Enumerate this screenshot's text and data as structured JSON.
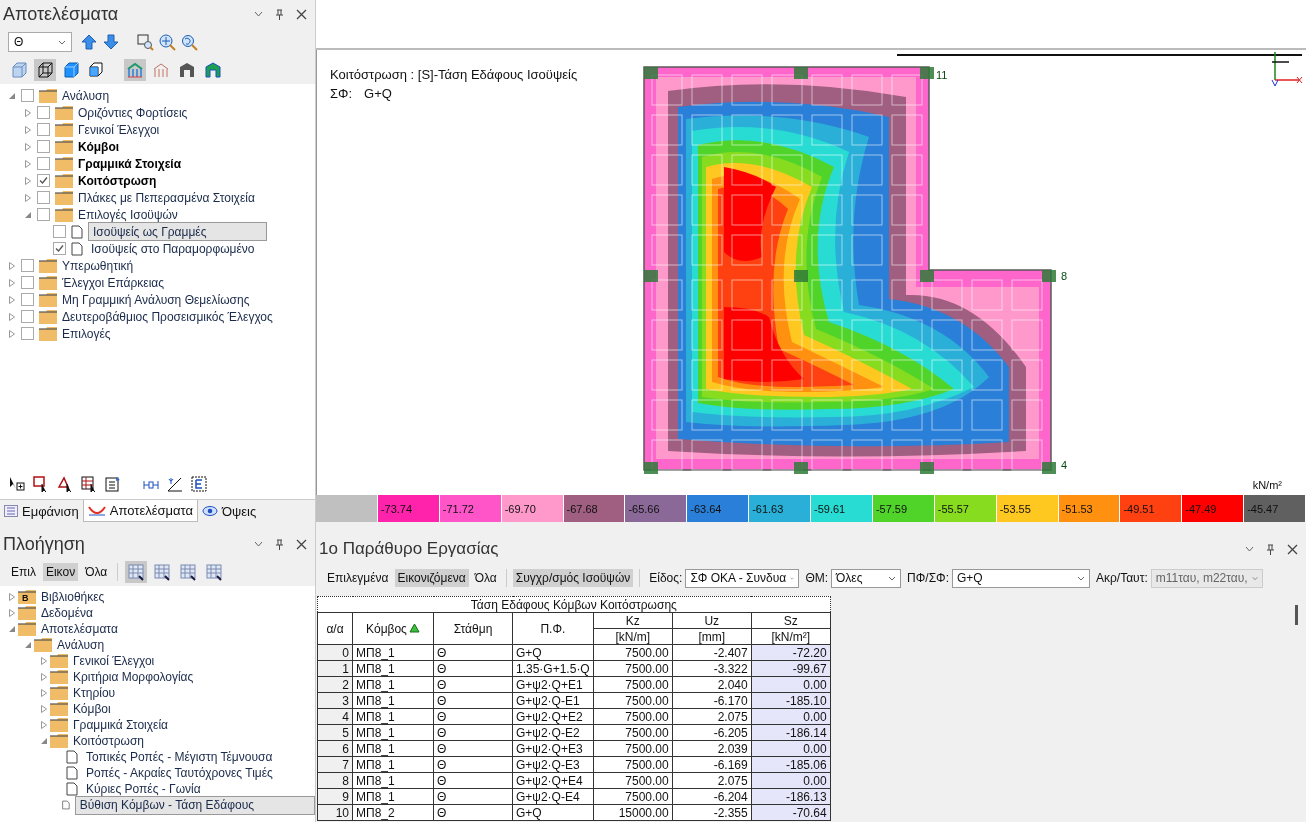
{
  "results_panel": {
    "title": "Αποτελέσματα",
    "level_select": {
      "value": "Θ"
    },
    "view_tools": [
      {
        "selected": false
      },
      {
        "selected": true
      },
      {
        "selected": false
      },
      {
        "selected": false
      },
      {
        "selected": true
      },
      {
        "selected": false
      },
      {
        "selected": false
      },
      {
        "selected": false
      }
    ],
    "tree": [
      {
        "label": "Ανάλυση",
        "kind": "folder",
        "checked": false,
        "expanded": true,
        "bold": false,
        "selected": false,
        "children": [
          {
            "label": "Οριζόντιες Φορτίσεις",
            "kind": "folder",
            "checked": false,
            "expanded": false,
            "bold": false,
            "selected": false
          },
          {
            "label": "Γενικοί Έλεγχοι",
            "kind": "folder",
            "checked": false,
            "expanded": false,
            "bold": false,
            "selected": false
          },
          {
            "label": "Κόμβοι",
            "kind": "folder",
            "checked": false,
            "expanded": false,
            "bold": true,
            "selected": false
          },
          {
            "label": "Γραμμικά Στοιχεία",
            "kind": "folder",
            "checked": false,
            "expanded": false,
            "bold": true,
            "selected": false
          },
          {
            "label": "Κοιτόστρωση",
            "kind": "folder",
            "checked": true,
            "expanded": false,
            "bold": true,
            "selected": false
          },
          {
            "label": "Πλάκες με Πεπερασμένα Στοιχεία",
            "kind": "folder",
            "checked": false,
            "expanded": false,
            "bold": false,
            "selected": false
          },
          {
            "label": "Επιλογές Ισοϋψών",
            "kind": "folder",
            "checked": false,
            "expanded": true,
            "bold": false,
            "selected": false,
            "children": [
              {
                "label": "Ισοϋψείς ως Γραμμές",
                "kind": "doc",
                "checked": false,
                "bold": false,
                "selected": true
              },
              {
                "label": "Ισοϋψείς στο Παραμορφωμένο",
                "kind": "doc",
                "checked": true,
                "bold": false,
                "selected": false
              }
            ]
          }
        ]
      },
      {
        "label": "Υπερωθητική",
        "kind": "folder",
        "checked": false,
        "expanded": false,
        "bold": false,
        "selected": false
      },
      {
        "label": "Έλεγχοι Επάρκειας",
        "kind": "folder",
        "checked": false,
        "expanded": false,
        "bold": false,
        "selected": false
      },
      {
        "label": "Μη Γραμμική Ανάλυση Θεμελίωσης",
        "kind": "folder",
        "checked": false,
        "expanded": false,
        "bold": false,
        "selected": false
      },
      {
        "label": "Δευτεροβάθμιος Προσεισμικός Έλεγχος",
        "kind": "folder",
        "checked": false,
        "expanded": false,
        "bold": false,
        "selected": false
      },
      {
        "label": "Επιλογές",
        "kind": "folder",
        "checked": false,
        "expanded": false,
        "bold": false,
        "selected": false
      }
    ]
  },
  "bottom_tabs": [
    {
      "label": "Εμφάνιση",
      "selected": false
    },
    {
      "label": "Αποτελέσματα",
      "selected": true
    },
    {
      "label": "Όψεις",
      "selected": false
    }
  ],
  "navigation_panel": {
    "title": "Πλοήγηση",
    "filters": [
      {
        "label": "Επιλ",
        "selected": false
      },
      {
        "label": "Εικον",
        "selected": true
      },
      {
        "label": "Όλα",
        "selected": false
      }
    ],
    "table_tools": [
      {
        "selected": true
      },
      {
        "selected": false
      },
      {
        "selected": false
      },
      {
        "selected": false
      }
    ],
    "tree": [
      {
        "label": "Βιβλιοθήκες",
        "kind": "folder",
        "badge": "B",
        "expanded": false,
        "selected": false
      },
      {
        "label": "Δεδομένα",
        "kind": "folder",
        "expanded": false,
        "selected": false
      },
      {
        "label": "Αποτελέσματα",
        "kind": "folder",
        "expanded": true,
        "selected": false,
        "children": [
          {
            "label": "Ανάλυση",
            "kind": "folder",
            "expanded": true,
            "selected": false,
            "children": [
              {
                "label": "Γενικοί Έλεγχοι",
                "kind": "folder",
                "expanded": false,
                "selected": false
              },
              {
                "label": "Κριτήρια Μορφολογίας",
                "kind": "folder",
                "expanded": false,
                "selected": false
              },
              {
                "label": "Κτηρίου",
                "kind": "folder",
                "expanded": false,
                "selected": false
              },
              {
                "label": "Κόμβοι",
                "kind": "folder",
                "expanded": false,
                "selected": false
              },
              {
                "label": "Γραμμικά Στοιχεία",
                "kind": "folder",
                "expanded": false,
                "selected": false
              },
              {
                "label": "Κοιτόστρωση",
                "kind": "folder",
                "expanded": true,
                "selected": false,
                "children": [
                  {
                    "label": "Τοπικές Ροπές - Μέγιστη Τέμνουσα",
                    "kind": "doc",
                    "selected": false
                  },
                  {
                    "label": "Ροπές - Ακραίες Ταυτόχρονες Τιμές",
                    "kind": "doc",
                    "selected": false
                  },
                  {
                    "label": "Κύριες Ροπές - Γωνία",
                    "kind": "doc",
                    "selected": false
                  },
                  {
                    "label": "Βύθιση Κόμβων - Τάση Εδάφους",
                    "kind": "doc",
                    "selected": true
                  }
                ]
              }
            ]
          }
        ]
      }
    ]
  },
  "drawing": {
    "title": "Κοιτόστρωση : [S]-Τάση Εδάφους Ισοϋψείς",
    "combo_label": "ΣΦ:",
    "combo": "G+Q",
    "node_labels": [
      "11",
      "8",
      "4"
    ],
    "unit": "kN/m²",
    "legend": [
      {
        "color": "#c0c0c0"
      },
      {
        "label": "-73.74",
        "color": "#ff22aa"
      },
      {
        "label": "-71.72",
        "color": "#ff55c8"
      },
      {
        "label": "-69.70",
        "color": "#ff99cc"
      },
      {
        "label": "-67.68",
        "color": "#a05e80"
      },
      {
        "label": "-65.66",
        "color": "#8a6898"
      },
      {
        "label": "-63.64",
        "color": "#2a7fd8"
      },
      {
        "label": "-61.63",
        "color": "#2ab0d8"
      },
      {
        "label": "-59.61",
        "color": "#28dcd4"
      },
      {
        "label": "-57.59",
        "color": "#50d42a"
      },
      {
        "label": "-55.57",
        "color": "#88dc20"
      },
      {
        "label": "-53.55",
        "color": "#ffc820"
      },
      {
        "label": "-51.53",
        "color": "#ff9010"
      },
      {
        "label": "-49.51",
        "color": "#ff4010"
      },
      {
        "label": "-47.49",
        "color": "#ff0000"
      },
      {
        "label": "-45.47",
        "color": "#606060"
      }
    ]
  },
  "work_window": {
    "title": "1ο Παράθυρο Εργασίας",
    "filters": [
      {
        "label": "Επιλεγμένα",
        "selected": false
      },
      {
        "label": "Εικονιζόμενα",
        "selected": true
      },
      {
        "label": "Όλα",
        "selected": false
      }
    ],
    "sync_button": {
      "label": "Συγχρ/σμός Ισοϋψών",
      "on": true
    },
    "selects": [
      {
        "label": "Είδος:",
        "value": "ΣΦ ΟΚΑ - Συνδυα",
        "disabled": false
      },
      {
        "label": "ΘΜ:",
        "value": "Όλες",
        "disabled": false
      },
      {
        "label": "ΠΦ/ΣΦ:",
        "value": "G+Q",
        "disabled": false
      },
      {
        "label": "Ακρ/Ταυτ:",
        "value": "m11ταυ, m22ταυ,",
        "disabled": true
      }
    ],
    "table": {
      "title": "Τάση Εδάφους Κόμβων Κοιτόστρωσης",
      "columns": [
        {
          "label": "α/α",
          "sorted": false
        },
        {
          "label": "Κόμβος",
          "sorted": true
        },
        {
          "label": "Στάθμη",
          "sorted": false
        },
        {
          "label": "Π.Φ.",
          "sorted": false
        },
        {
          "label": "Kz",
          "unit": "[kN/m]",
          "sorted": false
        },
        {
          "label": "Uz",
          "unit": "[mm]",
          "sorted": false
        },
        {
          "label": "Sz",
          "unit": "[kN/m²]",
          "sorted": false
        }
      ],
      "rows": [
        [
          "0",
          "ΜΠ8_1",
          "Θ",
          "G+Q",
          "7500.00",
          "-2.407",
          "-72.20"
        ],
        [
          "1",
          "ΜΠ8_1",
          "Θ",
          "1.35·G+1.5·Q",
          "7500.00",
          "-3.322",
          "-99.67"
        ],
        [
          "2",
          "ΜΠ8_1",
          "Θ",
          "G+ψ2·Q+E1",
          "7500.00",
          "2.040",
          "0.00"
        ],
        [
          "3",
          "ΜΠ8_1",
          "Θ",
          "G+ψ2·Q-E1",
          "7500.00",
          "-6.170",
          "-185.10"
        ],
        [
          "4",
          "ΜΠ8_1",
          "Θ",
          "G+ψ2·Q+E2",
          "7500.00",
          "2.075",
          "0.00"
        ],
        [
          "5",
          "ΜΠ8_1",
          "Θ",
          "G+ψ2·Q-E2",
          "7500.00",
          "-6.205",
          "-186.14"
        ],
        [
          "6",
          "ΜΠ8_1",
          "Θ",
          "G+ψ2·Q+E3",
          "7500.00",
          "2.039",
          "0.00"
        ],
        [
          "7",
          "ΜΠ8_1",
          "Θ",
          "G+ψ2·Q-E3",
          "7500.00",
          "-6.169",
          "-185.06"
        ],
        [
          "8",
          "ΜΠ8_1",
          "Θ",
          "G+ψ2·Q+E4",
          "7500.00",
          "2.075",
          "0.00"
        ],
        [
          "9",
          "ΜΠ8_1",
          "Θ",
          "G+ψ2·Q-E4",
          "7500.00",
          "-6.204",
          "-186.13"
        ],
        [
          "10",
          "ΜΠ8_2",
          "Θ",
          "G+Q",
          "15000.00",
          "-2.355",
          "-70.64"
        ]
      ]
    }
  }
}
